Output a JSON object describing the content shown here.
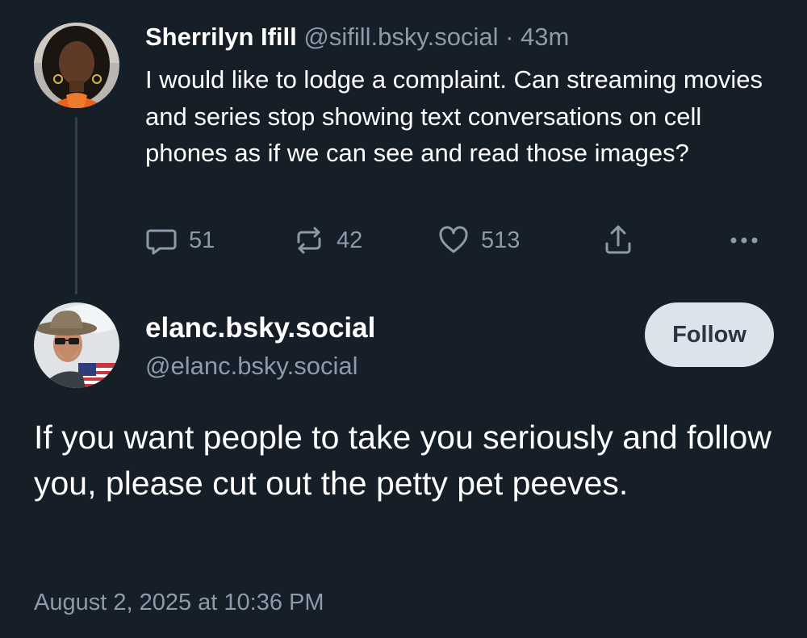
{
  "parent_post": {
    "author_name": "Sherrilyn Ifill",
    "author_handle": "@sifill.bsky.social",
    "separator": "·",
    "time_ago": "43m",
    "text": "I would like to lodge a complaint. Can streaming movies and series stop showing text conversations on cell phones as if we can see and read those images?",
    "actions": {
      "reply_count": "51",
      "repost_count": "42",
      "like_count": "513"
    }
  },
  "reply_post": {
    "display_name": "elanc.bsky.social",
    "handle": "@elanc.bsky.social",
    "follow_label": "Follow",
    "text": "If you want people to take you seriously and follow you, please cut out the petty pet peeves.",
    "timestamp": "August 2, 2025 at 10:36 PM"
  },
  "colors": {
    "background": "#161e27",
    "muted_text": "#8c9bab",
    "thread_line": "#2f3f4f",
    "follow_button_bg": "#dde3ea"
  },
  "icons": {
    "reply": "speech-bubble-icon",
    "repost": "repost-arrows-icon",
    "like": "heart-icon",
    "share": "share-upload-icon",
    "more": "ellipsis-icon"
  }
}
